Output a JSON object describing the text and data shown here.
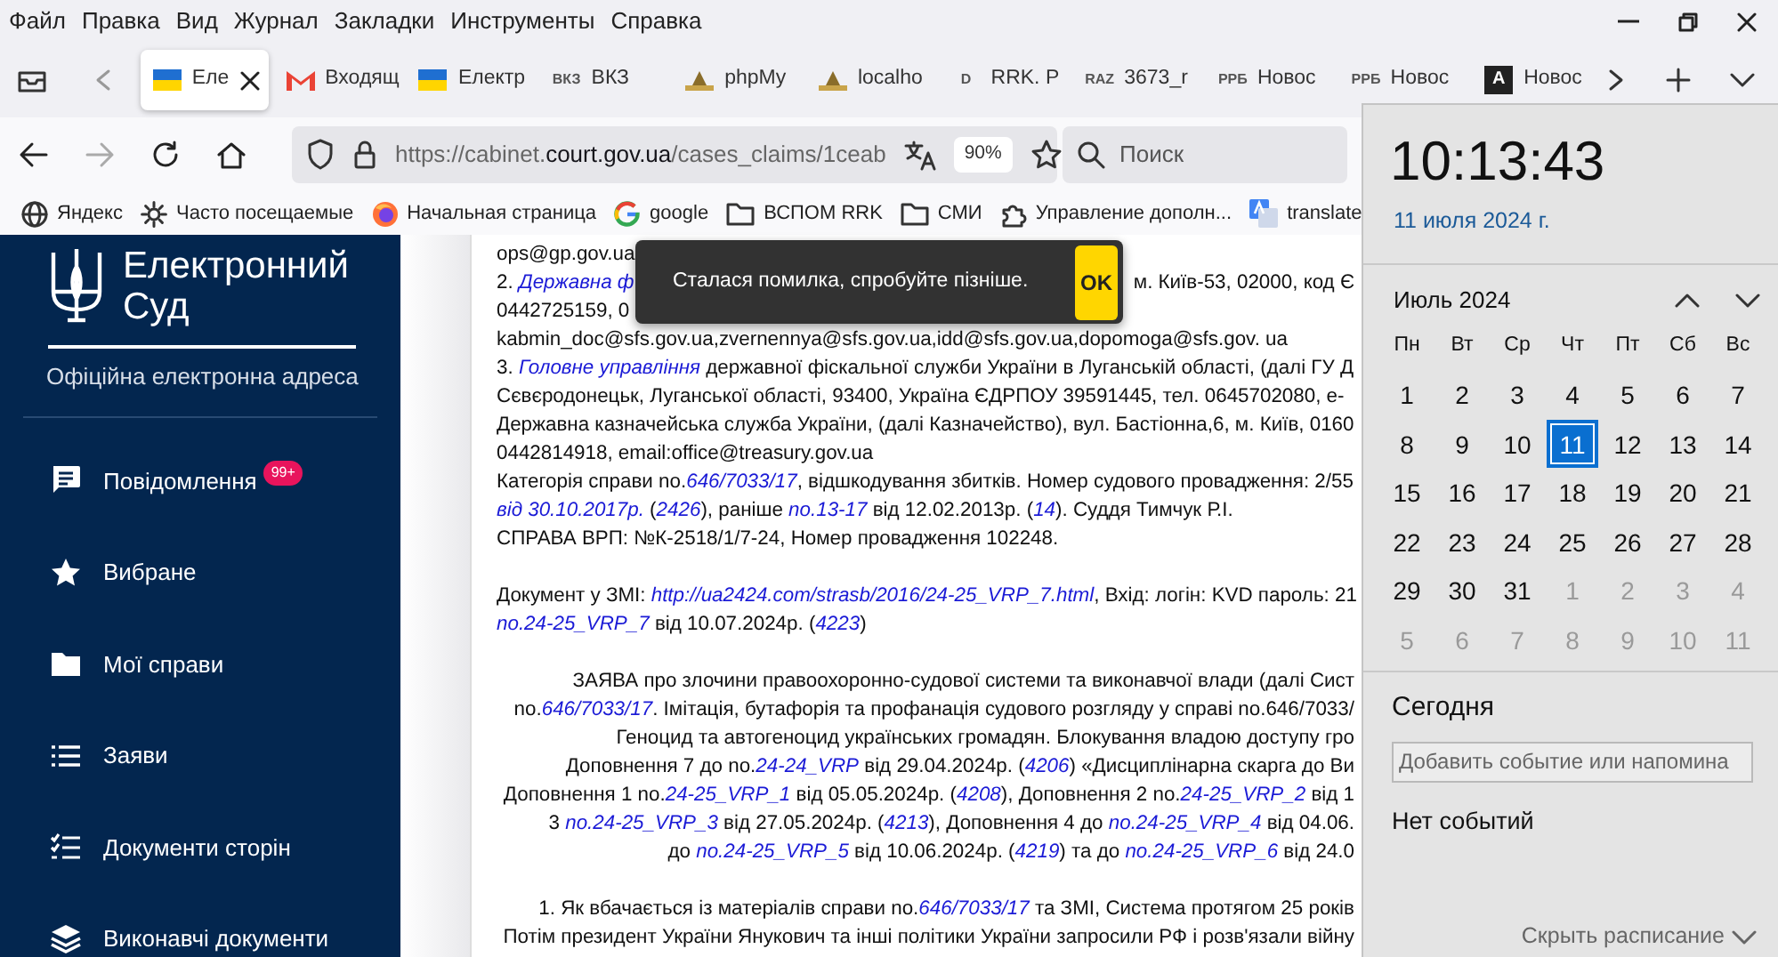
{
  "menu_bar": [
    "Файл",
    "Правка",
    "Вид",
    "Журнал",
    "Закладки",
    "Инструменты",
    "Справка"
  ],
  "tabs": [
    {
      "label": "Еле",
      "selected": true,
      "kind": "flag"
    },
    {
      "label": "Входящ",
      "selected": false,
      "kind": "mail"
    },
    {
      "label": "Електр",
      "selected": false,
      "kind": "flag"
    },
    {
      "label": "ВКЗ",
      "selected": false,
      "kind": "text",
      "favicon_text": "ВКЗ"
    },
    {
      "label": "phpMy",
      "selected": false,
      "kind": "image"
    },
    {
      "label": "localho",
      "selected": false,
      "kind": "image"
    },
    {
      "label": "RRK. P",
      "selected": false,
      "kind": "text",
      "favicon_text": "D"
    },
    {
      "label": "3673_r",
      "selected": false,
      "kind": "text",
      "favicon_text": "RAZ"
    },
    {
      "label": "Новос",
      "selected": false,
      "kind": "text",
      "favicon_text": "РРБ"
    },
    {
      "label": "Новос",
      "selected": false,
      "kind": "text",
      "favicon_text": "РРБ"
    },
    {
      "label": "Новос",
      "selected": false,
      "kind": "dark",
      "favicon_text": "A"
    }
  ],
  "address_bar": {
    "url_prefix": "https://cabinet.",
    "domain": "court.gov.ua",
    "url_path": "/cases_claims/1ceab",
    "zoom": "90%"
  },
  "search": {
    "placeholder": "Поиск"
  },
  "bookmarks": [
    {
      "label": "Яндекс",
      "kind": "globe"
    },
    {
      "label": "Часто посещаемые",
      "kind": "gear"
    },
    {
      "label": "Начальная страница",
      "kind": "firefox"
    },
    {
      "label": "google",
      "kind": "google"
    },
    {
      "label": "ВСПОМ RRK",
      "kind": "folder"
    },
    {
      "label": "СМИ",
      "kind": "folder"
    },
    {
      "label": "Управление дополн...",
      "kind": "puzzle"
    },
    {
      "label": "translate",
      "kind": "translate"
    }
  ],
  "sidebar": {
    "title_line1": "Електронний",
    "title_line2": "Суд",
    "subtitle": "Офіційна електронна адреса",
    "items": [
      {
        "label": "Повідомлення",
        "kind": "chat",
        "badge": "99+"
      },
      {
        "label": "Вибране",
        "kind": "star"
      },
      {
        "label": "Мої справи",
        "kind": "folder"
      },
      {
        "label": "Заяви",
        "kind": "list"
      },
      {
        "label": "Документи сторін",
        "kind": "checklist"
      },
      {
        "label": "Виконавчі документи",
        "kind": "layers"
      }
    ]
  },
  "document": {
    "lines": [
      {
        "kind": "plain",
        "segments": [
          "ops@gp.gov.ua"
        ]
      },
      {
        "kind": "split",
        "segments": [
          "2. ",
          {
            "link": "Державна ф"
          }
        ],
        "right_segments": [
          "м. Київ-53, 02000, код Є"
        ]
      },
      {
        "kind": "plain",
        "segments": [
          "0442725159, 0"
        ]
      },
      {
        "kind": "plain",
        "segments": [
          "kabmin_doc@sfs.gov.ua,zvernennya@sfs.gov.ua,idd@sfs.gov.ua,dopomoga@sfs.gov. ua"
        ]
      },
      {
        "kind": "plain",
        "segments": [
          "3. ",
          {
            "link": "Головне управління"
          },
          " державної фіскальної служби України в Луганській області, (далі ГУ Д"
        ]
      },
      {
        "kind": "plain",
        "segments": [
          "Сєвєродонецьк, Луганської області, 93400, Україна ЄДРПОУ 39591445, тел. 0645702080, е-"
        ]
      },
      {
        "kind": "plain",
        "segments": [
          "Державна казначейська служба України, (далі Казначейство), вул. Бастіонна,6, м. Київ, 0160"
        ]
      },
      {
        "kind": "plain",
        "segments": [
          "0442814918, email:office@treasury.gov.ua"
        ]
      },
      {
        "kind": "plain",
        "segments": [
          "Категорія справи no.",
          {
            "link": "646/7033/17"
          },
          ", відшкодування збитків. Номер судового провадження: 2/55"
        ]
      },
      {
        "kind": "plain",
        "segments": [
          {
            "link": "від 30.10.2017р."
          },
          " (",
          {
            "link": "2426"
          },
          "), раніше ",
          {
            "link": "no.13-17"
          },
          " від 12.02.2013р. (",
          {
            "link": "14"
          },
          "). Суддя Тимчук Р.І."
        ]
      },
      {
        "kind": "plain",
        "segments": [
          "СПРАВА ВРП: №К-2518/1/7-24, Номер провадження 102248."
        ]
      },
      {
        "kind": "blank"
      },
      {
        "kind": "plain",
        "segments": [
          "Документ у ЗМІ: ",
          {
            "link": "http://ua2424.com/strasb/2016/24-25_VRP_7.html"
          },
          ", Вхід: логін: KVD пароль: 21"
        ]
      },
      {
        "kind": "plain",
        "segments": [
          {
            "link": "no.24-25_VRP_7"
          },
          " від 10.07.2024р. (",
          {
            "link": "4223"
          },
          ")"
        ]
      },
      {
        "kind": "blank"
      },
      {
        "kind": "centered",
        "segments": [
          "ЗАЯВА про злочини правоохоронно-судової системи та виконавчої влади (далі Сист"
        ]
      },
      {
        "kind": "centered",
        "segments": [
          "no.",
          {
            "link": "646/7033/17"
          },
          ". Імітація, бутафорія та профанація судового розгляду у справі no.646/7033/"
        ]
      },
      {
        "kind": "centered",
        "segments": [
          "Геноцид та автогеноцид українських громадян. Блокування владою доступу гро"
        ]
      },
      {
        "kind": "centered",
        "segments": [
          "Доповнення 7 до no.",
          {
            "link": "24-24_VRP"
          },
          " від 29.04.2024р. (",
          {
            "link": "4206"
          },
          ") «Дисциплінарна скарга до Ви"
        ]
      },
      {
        "kind": "centered",
        "segments": [
          "Доповнення 1 no.",
          {
            "link": "24-25_VRP_1"
          },
          " від 05.05.2024р. (",
          {
            "link": "4208"
          },
          "), Доповнення 2 no.",
          {
            "link": "24-25_VRP_2"
          },
          " від 1"
        ]
      },
      {
        "kind": "centered",
        "segments": [
          "3 ",
          {
            "link": "no.24-25_VRP_3"
          },
          " від 27.05.2024р. (",
          {
            "link": "4213"
          },
          "), Доповнення 4 до ",
          {
            "link": "no.24-25_VRP_4"
          },
          " від 04.06."
        ]
      },
      {
        "kind": "centered",
        "segments": [
          "до ",
          {
            "link": "no.24-25_VRP_5"
          },
          " від 10.06.2024р. (",
          {
            "link": "4219"
          },
          ") та до ",
          {
            "link": "no.24-25_VRP_6"
          },
          " від 24.0"
        ]
      },
      {
        "kind": "blank"
      },
      {
        "kind": "centered",
        "segments": [
          "1. Як вбачається із матеріалів справи no.",
          {
            "link": "646/7033/17"
          },
          " та ЗМІ, Система протягом 25 років"
        ]
      },
      {
        "kind": "centered",
        "segments": [
          "Потім президент України Янукович та інші політики України запросили РФ і розв'язали війну"
        ]
      }
    ]
  },
  "toast": {
    "message": "Сталася помилка, спробуйте пізніше.",
    "button": "OK"
  },
  "clock": {
    "time": "10:13:43",
    "date": "11 июля 2024 г.",
    "month": "Июль 2024",
    "weekdays": [
      "Пн",
      "Вт",
      "Ср",
      "Чт",
      "Пт",
      "Сб",
      "Вс"
    ],
    "weeks": [
      [
        {
          "day": "1",
          "other_month": false,
          "selected": false
        },
        {
          "day": "2",
          "other_month": false,
          "selected": false
        },
        {
          "day": "3",
          "other_month": false,
          "selected": false
        },
        {
          "day": "4",
          "other_month": false,
          "selected": false
        },
        {
          "day": "5",
          "other_month": false,
          "selected": false
        },
        {
          "day": "6",
          "other_month": false,
          "selected": false
        },
        {
          "day": "7",
          "other_month": false,
          "selected": false
        }
      ],
      [
        {
          "day": "8",
          "other_month": false,
          "selected": false
        },
        {
          "day": "9",
          "other_month": false,
          "selected": false
        },
        {
          "day": "10",
          "other_month": false,
          "selected": false
        },
        {
          "day": "11",
          "other_month": false,
          "selected": true
        },
        {
          "day": "12",
          "other_month": false,
          "selected": false
        },
        {
          "day": "13",
          "other_month": false,
          "selected": false
        },
        {
          "day": "14",
          "other_month": false,
          "selected": false
        }
      ],
      [
        {
          "day": "15",
          "other_month": false,
          "selected": false
        },
        {
          "day": "16",
          "other_month": false,
          "selected": false
        },
        {
          "day": "17",
          "other_month": false,
          "selected": false
        },
        {
          "day": "18",
          "other_month": false,
          "selected": false
        },
        {
          "day": "19",
          "other_month": false,
          "selected": false
        },
        {
          "day": "20",
          "other_month": false,
          "selected": false
        },
        {
          "day": "21",
          "other_month": false,
          "selected": false
        }
      ],
      [
        {
          "day": "22",
          "other_month": false,
          "selected": false
        },
        {
          "day": "23",
          "other_month": false,
          "selected": false
        },
        {
          "day": "24",
          "other_month": false,
          "selected": false
        },
        {
          "day": "25",
          "other_month": false,
          "selected": false
        },
        {
          "day": "26",
          "other_month": false,
          "selected": false
        },
        {
          "day": "27",
          "other_month": false,
          "selected": false
        },
        {
          "day": "28",
          "other_month": false,
          "selected": false
        }
      ],
      [
        {
          "day": "29",
          "other_month": false,
          "selected": false
        },
        {
          "day": "30",
          "other_month": false,
          "selected": false
        },
        {
          "day": "31",
          "other_month": false,
          "selected": false
        },
        {
          "day": "1",
          "other_month": true,
          "selected": false
        },
        {
          "day": "2",
          "other_month": true,
          "selected": false
        },
        {
          "day": "3",
          "other_month": true,
          "selected": false
        },
        {
          "day": "4",
          "other_month": true,
          "selected": false
        }
      ],
      [
        {
          "day": "5",
          "other_month": true,
          "selected": false
        },
        {
          "day": "6",
          "other_month": true,
          "selected": false
        },
        {
          "day": "7",
          "other_month": true,
          "selected": false
        },
        {
          "day": "8",
          "other_month": true,
          "selected": false
        },
        {
          "day": "9",
          "other_month": true,
          "selected": false
        },
        {
          "day": "10",
          "other_month": true,
          "selected": false
        },
        {
          "day": "11",
          "other_month": true,
          "selected": false
        }
      ]
    ],
    "today_heading": "Сегодня",
    "event_placeholder": "Добавить событие или напомина",
    "no_events": "Нет событий",
    "hide_schedule": "Скрыть расписание"
  }
}
